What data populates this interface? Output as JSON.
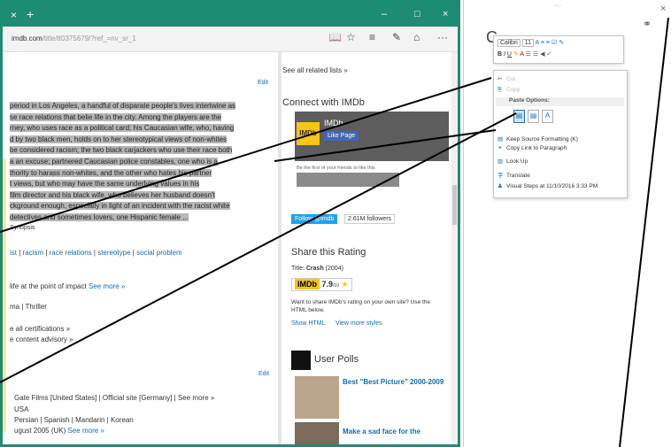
{
  "browser": {
    "tab_close": "×",
    "tab_new": "+",
    "win_min": "–",
    "win_max": "□",
    "win_close": "×",
    "url_host": "imdb.com",
    "url_path": "/title/tt0375679/?ref_=nv_sr_1",
    "icons": [
      "reading-view-icon",
      "favorite-star-icon",
      "hub-icon",
      "web-note-icon",
      "share-icon",
      "more-icon"
    ]
  },
  "left": {
    "edit1": "Edit",
    "synopsis_lines": [
      "period in Los Angeles, a handful of disparate people's lives intertwine as",
      "se race relations that belie life in the city. Among the players are the",
      "rney, who uses race as a political card; his Caucasian wife, who, having",
      "d by two black men, holds on to her stereotypical views of non-whites",
      "be considered racism; the two black carjackers who use their race both",
      "a an excuse; partnered Caucasian police constables, one who is a",
      "thority to harass non-whites, and the other who hates his partner",
      "t views, but who may have the same underlying values in his",
      " film director and his black wife, who believes her husband doesn't",
      "ckground enough, especially in light of an incident with the racist white",
      " detectives and sometimes lovers, one Hispanic female ..."
    ],
    "synopsis_link": "Synopsis",
    "keywords": [
      "ist",
      "racism",
      "race relations",
      "stereotype",
      "social problem"
    ],
    "tagline": "life at the point of impact",
    "see_more": "See more »",
    "genres": "ma | Thriller",
    "cert_link": "e all certifications »",
    "advisory_link": "e content advisory »",
    "edit2": "Edit",
    "companies": "Gate Films [United States] | Official site [Germany] | See more »",
    "country": "USA",
    "languages": "Persian | Spanish | Mandarin | Korean",
    "release": "ugust 2005 (UK)",
    "release_more": "See more »"
  },
  "right": {
    "related": "See all related lists »",
    "connect": "Connect with IMDb",
    "fb_name": "IMDb",
    "fb_like": "Like Page",
    "fb_friends": "Be the first of your friends to like this",
    "follow": "Follow @imdb",
    "followers": "2.61M followers",
    "share_title": "Share this Rating",
    "title_label": "Title:",
    "title_value": "Crash",
    "title_year": "(2004)",
    "rating": "7.9",
    "rating_sub": "/10",
    "share_text": "Want to share IMDb's rating on your own site? Use the HTML below.",
    "show_html": "Show HTML",
    "more_styles": "View more styles",
    "polls": "User Polls",
    "poll1": "Best \"Best Picture\" 2000-2009",
    "poll2": "Make a sad face for the"
  },
  "onenote": {
    "dots": "···",
    "close": "×",
    "title_char": "C",
    "ribbon_font": "Calibri",
    "ribbon_size": "11",
    "menu": {
      "cut": "Cut",
      "copy": "Copy",
      "paste_options": "Paste Options:",
      "keep_source": "Keep Source Formatting (K)",
      "copy_link": "Copy Link to Paragraph",
      "look_up": "Look Up",
      "translate": "Translate",
      "visual_steps": "Visual Steps at 11/10/2016 3:33 PM"
    }
  }
}
